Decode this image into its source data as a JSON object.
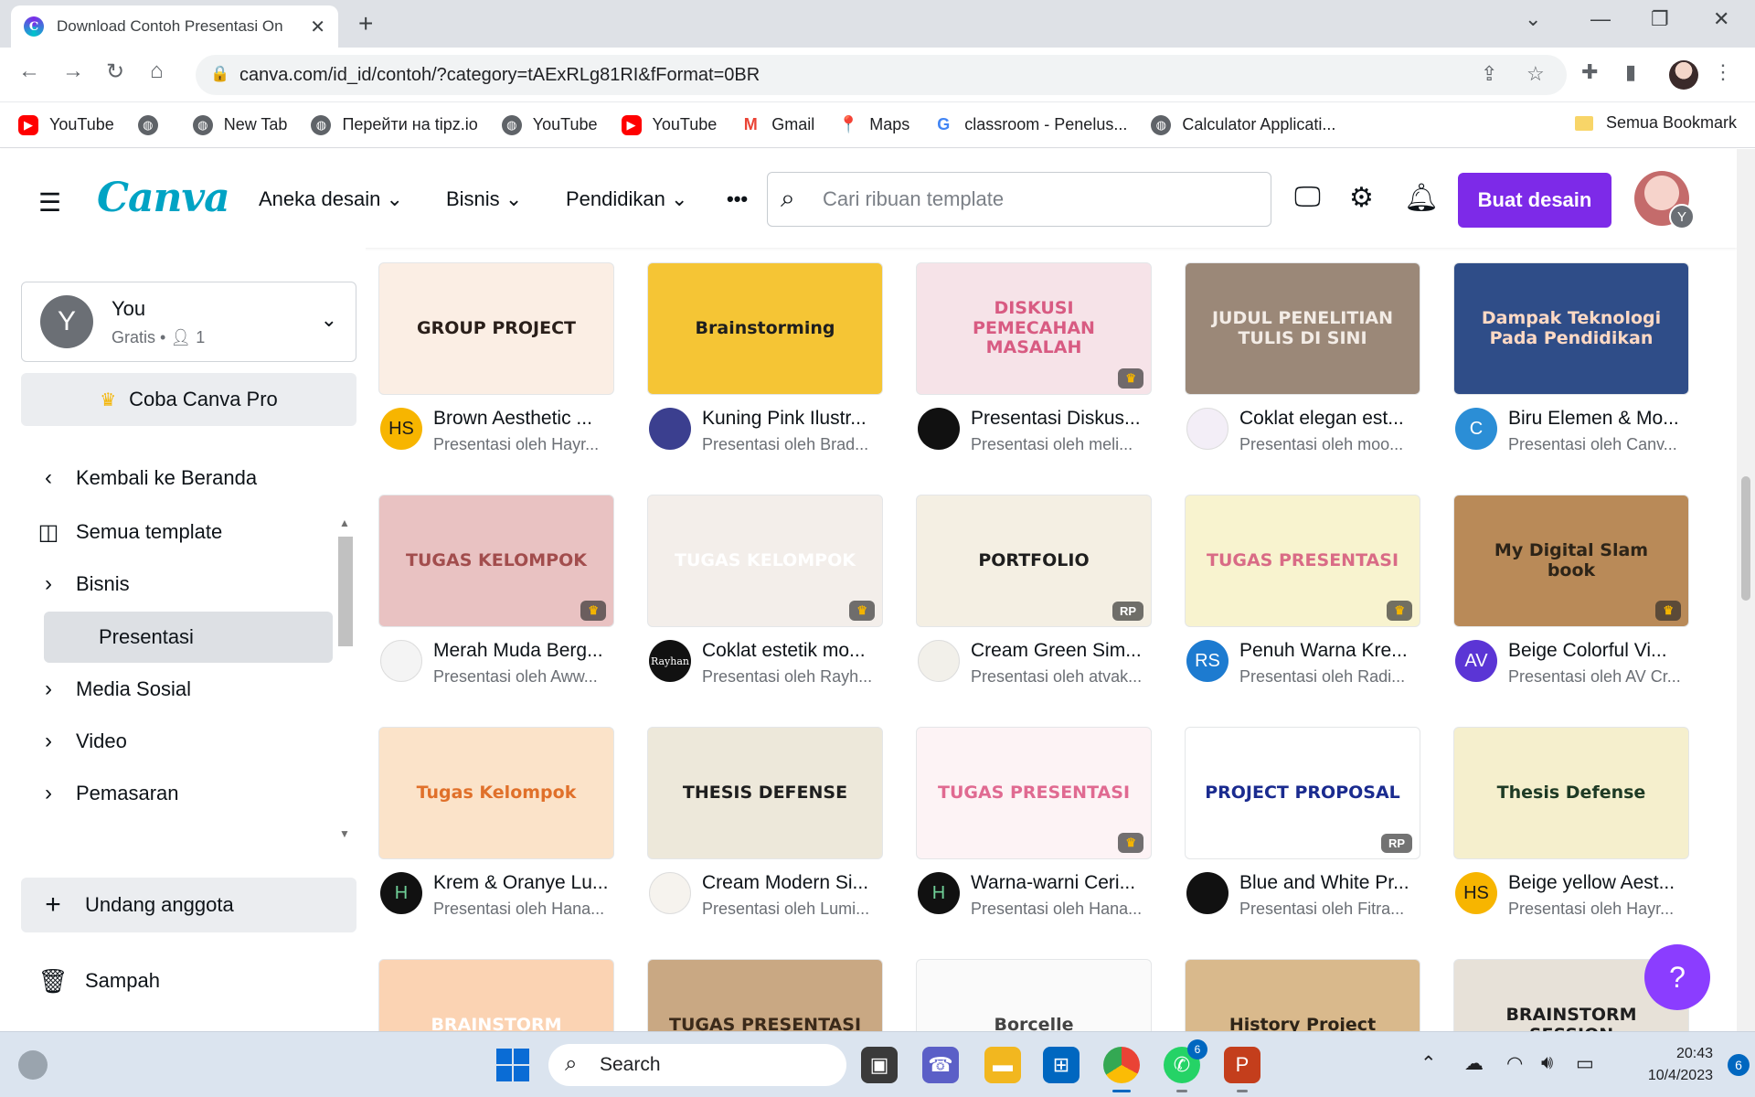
{
  "browser": {
    "tab_title": "Download Contoh Presentasi On",
    "tab_close": "✕",
    "new_tab": "+",
    "url": "canva.com/id_id/contoh/?category=tAExRLg81RI&fFormat=0BR",
    "bookmarks": [
      {
        "label": "YouTube",
        "icon": "youtube-icon"
      },
      {
        "label": "",
        "icon": "globe-icon"
      },
      {
        "label": "New Tab",
        "icon": "globe-icon"
      },
      {
        "label": "Перейти на tipz.io",
        "icon": "globe-icon"
      },
      {
        "label": "YouTube",
        "icon": "globe-icon"
      },
      {
        "label": "YouTube",
        "icon": "youtube-icon"
      },
      {
        "label": "Gmail",
        "icon": "gmail-icon"
      },
      {
        "label": "Maps",
        "icon": "maps-icon"
      },
      {
        "label": "classroom - Penelus...",
        "icon": "google-icon"
      },
      {
        "label": "Calculator Applicati...",
        "icon": "globe-icon"
      }
    ],
    "all_bookmarks": "Semua Bookmark"
  },
  "header": {
    "logo": "Canva",
    "nav": [
      "Aneka desain",
      "Bisnis",
      "Pendidikan"
    ],
    "more": "•••",
    "search_placeholder": "Cari ribuan template",
    "create_button": "Buat desain",
    "avatar_initial": "Y"
  },
  "sidebar": {
    "account_name": "You",
    "account_plan": "Gratis",
    "account_members": "1",
    "pro_button": "Coba Canva Pro",
    "back": "Kembali ke Beranda",
    "all_templates": "Semua template",
    "categories": [
      "Bisnis",
      "Presentasi",
      "Media Sosial",
      "Video",
      "Pemasaran"
    ],
    "invite": "Undang anggota",
    "trash": "Sampah"
  },
  "templates": [
    {
      "title": "Brown Aesthetic ...",
      "author": "Presentasi oleh Hayr...",
      "thumb_text": "GROUP PROJECT",
      "avatar": "HS",
      "badge": "",
      "bg": "#fbeee4",
      "fg": "#2a1f1a",
      "avbg": "#f7b500",
      "avfg": "#1a1a1a"
    },
    {
      "title": "Kuning Pink Ilustr...",
      "author": "Presentasi oleh Brad...",
      "thumb_text": "Brainstorming",
      "avatar": "",
      "badge": "",
      "bg": "#f5c535",
      "fg": "#1e1e1e",
      "avbg": "#3b3f8f",
      "avfg": "#fff"
    },
    {
      "title": "Presentasi Diskus...",
      "author": "Presentasi oleh meli...",
      "thumb_text": "DISKUSI PEMECAHAN MASALAH",
      "avatar": "",
      "badge": "♛",
      "bg": "#f6e3e8",
      "fg": "#d85b82",
      "avbg": "#111",
      "avfg": "#fff"
    },
    {
      "title": "Coklat elegan est...",
      "author": "Presentasi oleh moo...",
      "thumb_text": "JUDUL PENELITIAN TULIS DI SINI",
      "avatar": "",
      "badge": "",
      "bg": "#9b8878",
      "fg": "#f3ece6",
      "avbg": "#f3eef7",
      "avfg": "#9a7fb5"
    },
    {
      "title": "Biru Elemen & Mo...",
      "author": "Presentasi oleh Canv...",
      "thumb_text": "Dampak Teknologi Pada Pendidikan",
      "avatar": "C",
      "badge": "",
      "bg": "#2f4d88",
      "fg": "#ffd9c4",
      "avbg": "#2b8ed6",
      "avfg": "#fff"
    },
    {
      "title": "Merah Muda Berg...",
      "author": "Presentasi oleh Aww...",
      "thumb_text": "TUGAS KELOMPOK",
      "avatar": "",
      "badge": "♛",
      "bg": "#e9c2c2",
      "fg": "#a24d4d",
      "avbg": "#f4f4f4",
      "avfg": "#555"
    },
    {
      "title": "Coklat estetik mo...",
      "author": "Presentasi oleh Rayh...",
      "thumb_text": "TUGAS KELOMPOK",
      "avatar": "Rayhan",
      "badge": "♛",
      "bg": "#f3eeea",
      "fg": "#fff",
      "avbg": "#111",
      "avfg": "#fff"
    },
    {
      "title": "Cream Green Sim...",
      "author": "Presentasi oleh atvak...",
      "thumb_text": "PORTFOLIO",
      "avatar": "",
      "badge": "RP",
      "bg": "#f4efe3",
      "fg": "#1e1e1e",
      "avbg": "#f2f0ea",
      "avfg": "#333"
    },
    {
      "title": "Penuh Warna Kre...",
      "author": "Presentasi oleh Radi...",
      "thumb_text": "TUGAS PRESENTASI",
      "avatar": "RS",
      "badge": "♛",
      "bg": "#f8f3cf",
      "fg": "#d96b86",
      "avbg": "#1d7bd0",
      "avfg": "#fff"
    },
    {
      "title": "Beige Colorful Vi...",
      "author": "Presentasi oleh AV Cr...",
      "thumb_text": "My Digital Slam book",
      "avatar": "AV",
      "badge": "♛",
      "bg": "#b98a58",
      "fg": "#2d2418",
      "avbg": "#5b35d5",
      "avfg": "#fff"
    },
    {
      "title": "Krem & Oranye Lu...",
      "author": "Presentasi oleh Hana...",
      "thumb_text": "Tugas Kelompok",
      "avatar": "H",
      "badge": "",
      "bg": "#fbe3c9",
      "fg": "#e0702a",
      "avbg": "#111",
      "avfg": "#6fcf97"
    },
    {
      "title": "Cream Modern Si...",
      "author": "Presentasi oleh Lumi...",
      "thumb_text": "THESIS DEFENSE",
      "avatar": "",
      "badge": "",
      "bg": "#ede8da",
      "fg": "#1e1e1e",
      "avbg": "#f6f3ee",
      "avfg": "#777"
    },
    {
      "title": "Warna-warni Ceri...",
      "author": "Presentasi oleh Hana...",
      "thumb_text": "TUGAS PRESENTASI",
      "avatar": "H",
      "badge": "♛",
      "bg": "#fdf3f5",
      "fg": "#e06a91",
      "avbg": "#111",
      "avfg": "#6fcf97"
    },
    {
      "title": "Blue and White Pr...",
      "author": "Presentasi oleh Fitra...",
      "thumb_text": "PROJECT PROPOSAL",
      "avatar": "",
      "badge": "RP",
      "bg": "#ffffff",
      "fg": "#1a2b8f",
      "avbg": "#111",
      "avfg": "#fff"
    },
    {
      "title": "Beige yellow Aest...",
      "author": "Presentasi oleh Hayr...",
      "thumb_text": "Thesis Defense",
      "avatar": "HS",
      "badge": "",
      "bg": "#f5efcd",
      "fg": "#1e3a24",
      "avbg": "#f7b500",
      "avfg": "#1a1a1a"
    },
    {
      "title": "",
      "author": "",
      "thumb_text": "BRAINSTORM",
      "avatar": "",
      "badge": "",
      "bg": "#fbd3b3",
      "fg": "#fff",
      "avbg": "#fff",
      "avfg": "#fff"
    },
    {
      "title": "",
      "author": "",
      "thumb_text": "TUGAS PRESENTASI",
      "avatar": "",
      "badge": "",
      "bg": "#c9a883",
      "fg": "#3b2a1a",
      "avbg": "#fff",
      "avfg": "#fff"
    },
    {
      "title": "",
      "author": "",
      "thumb_text": "Borcelle",
      "avatar": "",
      "badge": "",
      "bg": "#fafafa",
      "fg": "#444",
      "avbg": "#fff",
      "avfg": "#fff"
    },
    {
      "title": "",
      "author": "",
      "thumb_text": "History Project",
      "avatar": "",
      "badge": "",
      "bg": "#d9b98c",
      "fg": "#2d2418",
      "avbg": "#fff",
      "avfg": "#fff"
    },
    {
      "title": "",
      "author": "",
      "thumb_text": "BRAINSTORM SESSION",
      "avatar": "",
      "badge": "",
      "bg": "#e7e1d8",
      "fg": "#1e1e1e",
      "avbg": "#fff",
      "avfg": "#fff"
    }
  ],
  "taskbar": {
    "search": "Search",
    "whatsapp_count": "6",
    "time": "20:43",
    "date": "10/4/2023",
    "notifications": "6"
  },
  "help_button": "?"
}
